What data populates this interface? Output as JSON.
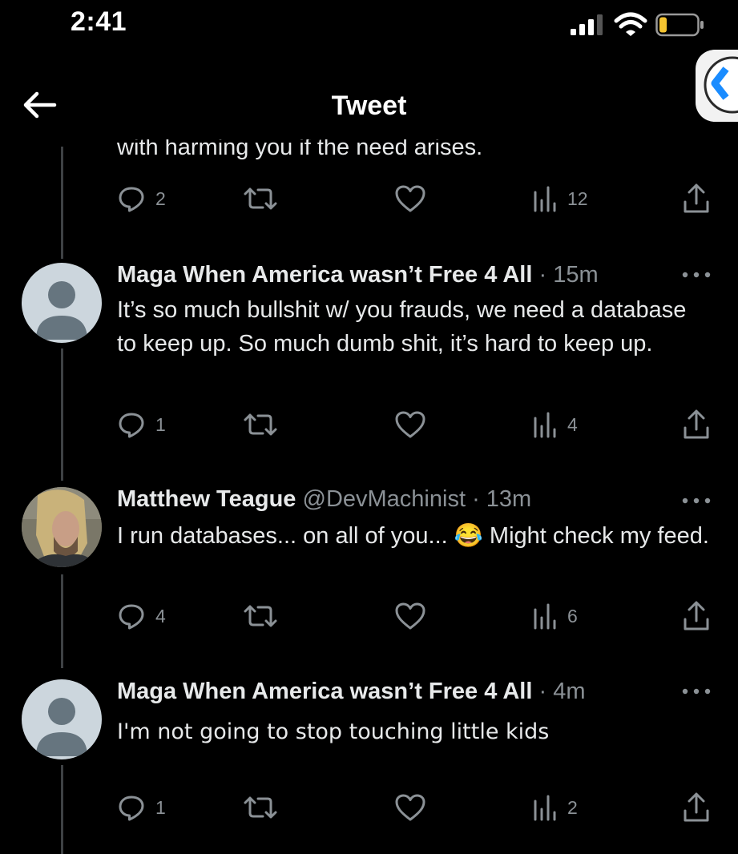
{
  "status_bar": {
    "time": "2:41"
  },
  "header": {
    "title": "Tweet"
  },
  "partial_tweet": {
    "text": "with harming you if the need arises.",
    "stats": {
      "replies": "2",
      "retweets": "",
      "likes": "",
      "views": "12"
    }
  },
  "tweets": [
    {
      "name": "Maga When America wasn’t Free 4 All",
      "handle": "",
      "dot": "·",
      "time": "15m",
      "text": "It’s so much bullshit w/ you frauds, we need a database to keep up. So much dumb shit, it’s hard to keep up.",
      "stats": {
        "replies": "1",
        "retweets": "",
        "likes": "",
        "views": "4"
      }
    },
    {
      "name": "Matthew Teague",
      "handle": "@DevMachinist",
      "dot": "·",
      "time": "13m",
      "text": "I run databases... on all of you... 😂 Might check my feed.",
      "stats": {
        "replies": "4",
        "retweets": "",
        "likes": "",
        "views": "6"
      }
    },
    {
      "name": "Maga When America wasn’t Free 4 All",
      "handle": "",
      "dot": "·",
      "time": "4m",
      "text": "I'm not going to stop touching little kids",
      "stats": {
        "replies": "1",
        "retweets": "",
        "likes": "",
        "views": "2"
      }
    }
  ],
  "colors": {
    "background": "#000000",
    "text": "#e7e9ea",
    "secondary": "#8b9196",
    "thread_line": "#3e4144"
  },
  "icons": [
    "back-arrow-icon",
    "reply-icon",
    "retweet-icon",
    "like-icon",
    "views-icon",
    "share-icon",
    "more-icon",
    "signal-icon",
    "wifi-icon",
    "battery-icon"
  ]
}
